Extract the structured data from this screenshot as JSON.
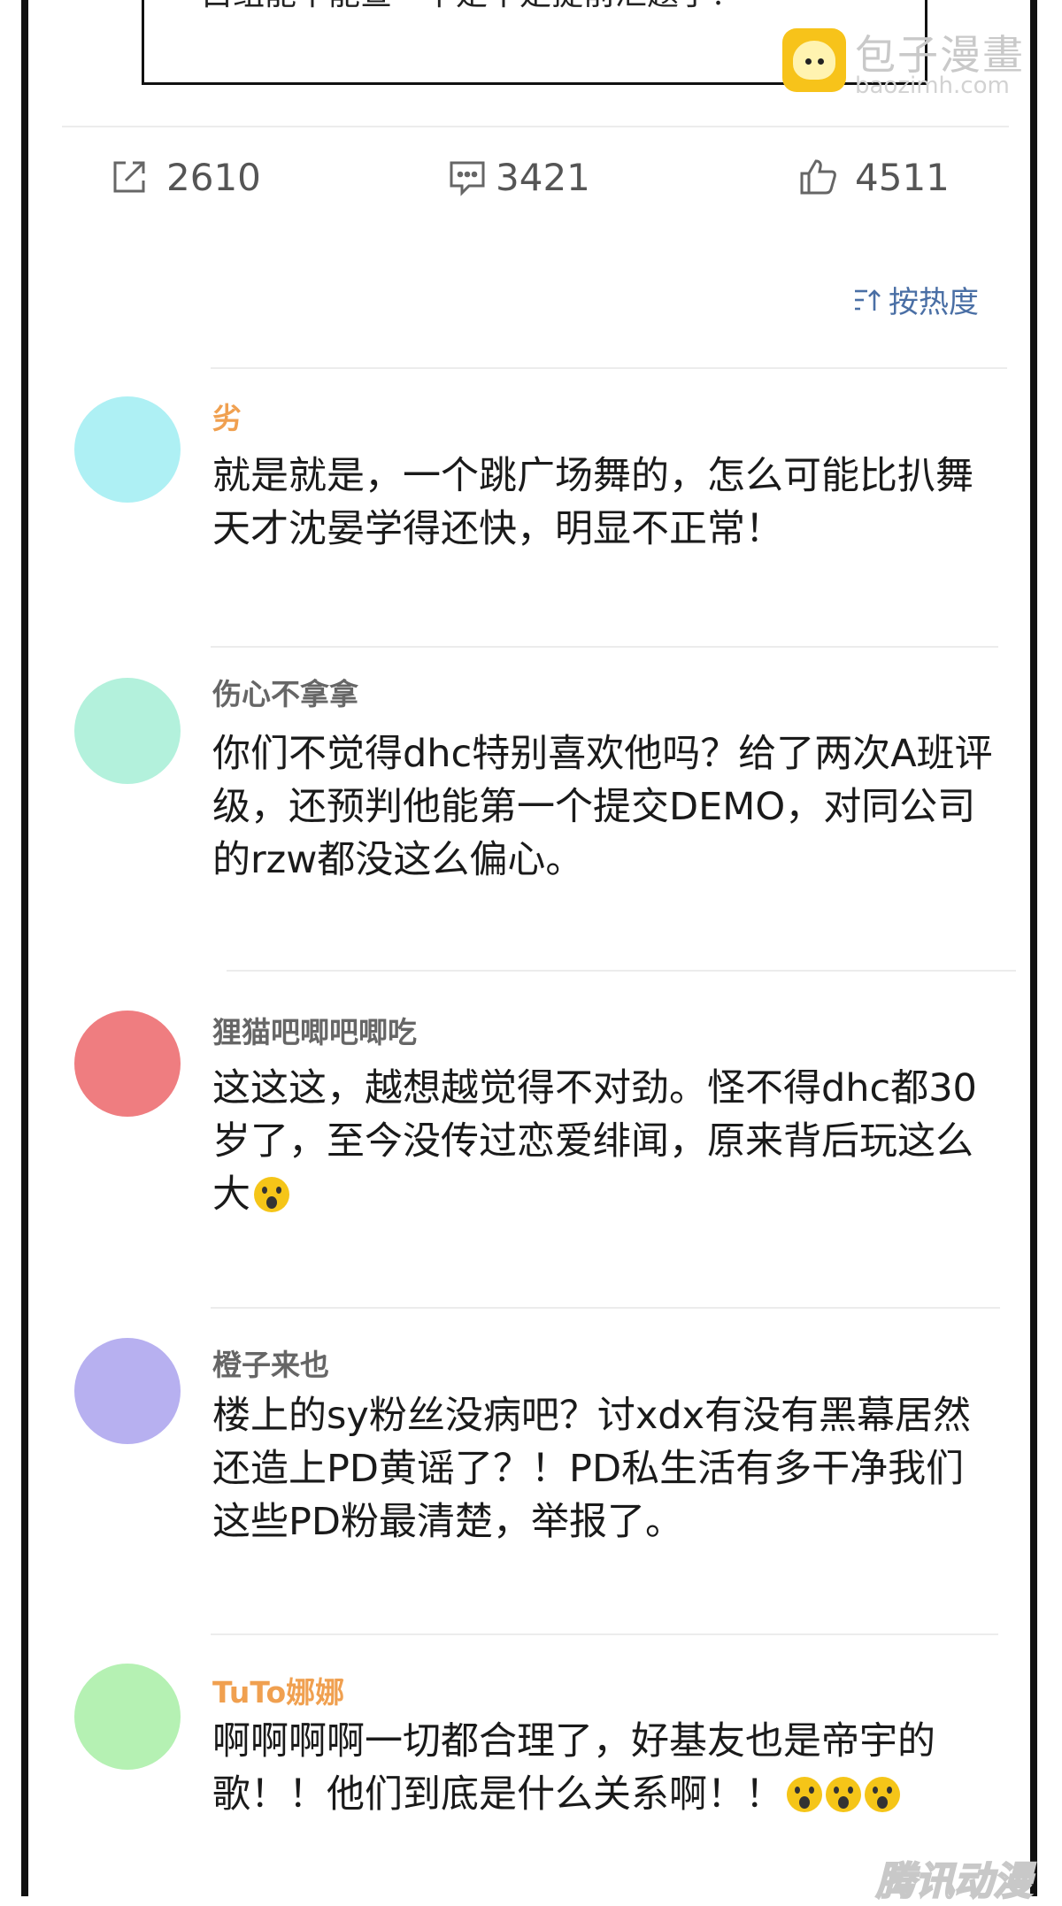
{
  "top_snippet": {
    "text": "白组能不能查一下是不是提前泄题了？"
  },
  "watermark": {
    "title": "包子漫畫",
    "url": "baozimh.com",
    "bottom_logo": "腾讯动漫"
  },
  "stats": {
    "share_count": "2610",
    "comment_count": "3421",
    "like_count": "4511"
  },
  "sort": {
    "label": "按热度"
  },
  "comments": [
    {
      "username": "劣",
      "username_color": "#f0a050",
      "avatar_color": "#aef0f4",
      "text": "就是就是，一个跳广场舞的，怎么可能比扒舞天才沈晏学得还快，明显不正常！"
    },
    {
      "username": "伤心不拿拿",
      "username_color": "#666666",
      "avatar_color": "#b3f1dc",
      "text": "你们不觉得dhc特别喜欢他吗？给了两次A班评级，还预判他能第一个提交DEMO，对同公司的rzw都没这么偏心。"
    },
    {
      "username": "狸猫吧唧吧唧吃",
      "username_color": "#666666",
      "avatar_color": "#ef7d80",
      "text": "这这这，越想越觉得不对劲。怪不得dhc都30岁了，至今没传过恋爱绯闻，原来背后玩这么大",
      "emoji_count": 1
    },
    {
      "username": "橙子来也",
      "username_color": "#666666",
      "avatar_color": "#b7b0f0",
      "text": "楼上的sy粉丝没病吧？讨xdx有没有黑幕居然还造上PD黄谣了？！PD私生活有多干净我们这些PD粉最清楚，举报了。"
    },
    {
      "username": "TuTo娜娜",
      "username_color": "#f0a050",
      "avatar_color": "#b5f1b3",
      "text": "啊啊啊啊一切都合理了，好基友也是帝宇的歌！！他们到底是什么关系啊！！",
      "emoji_count": 3
    }
  ]
}
